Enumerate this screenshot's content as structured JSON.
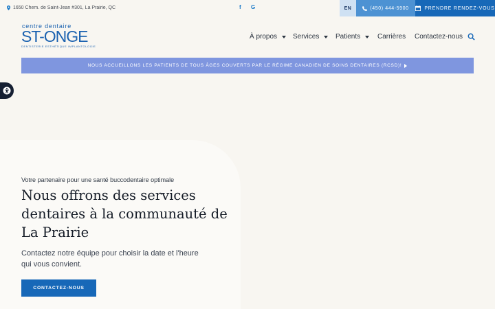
{
  "topbar": {
    "address": "1650 Chem. de Saint-Jean #301, La Prairie, QC",
    "social": [
      {
        "icon": "facebook-icon",
        "glyph": "f"
      },
      {
        "icon": "google-icon",
        "glyph": "G"
      }
    ],
    "lang": "EN",
    "phone": "(450) 444-5900",
    "appointment": "PRENDRE RENDEZ-VOUS"
  },
  "logo": {
    "line1": "centre dentaire",
    "line2": "ST-ONGE",
    "line3": "DENTISTERIE ESTHÉTIQUE IMPLANTOLOGIE"
  },
  "nav": {
    "items": [
      {
        "label": "À propos",
        "dropdown": true
      },
      {
        "label": "Services",
        "dropdown": true
      },
      {
        "label": "Patients",
        "dropdown": true
      },
      {
        "label": "Carrières",
        "dropdown": false
      },
      {
        "label": "Contactez-nous",
        "dropdown": false
      }
    ]
  },
  "banner": {
    "text": "NOUS ACCUEILLONS LES PATIENTS DE TOUS ÂGES COUVERTS PAR LE RÉGIME CANADIEN DE SOINS DENTAIRES (RCSD)!"
  },
  "hero": {
    "eyebrow": "Votre partenaire pour une santé buccodentaire optimale",
    "title": "Nous offrons des services dentaires à la communauté de La Prairie",
    "subtitle": "Contactez notre équipe pour choisir la date et l'heure qui vous convient.",
    "cta": "CONTACTEZ-NOUS"
  },
  "colors": {
    "brand": "#1768b8",
    "accent": "#4d92d3",
    "banner": "#7f96df",
    "background": "#f8f6f1"
  }
}
